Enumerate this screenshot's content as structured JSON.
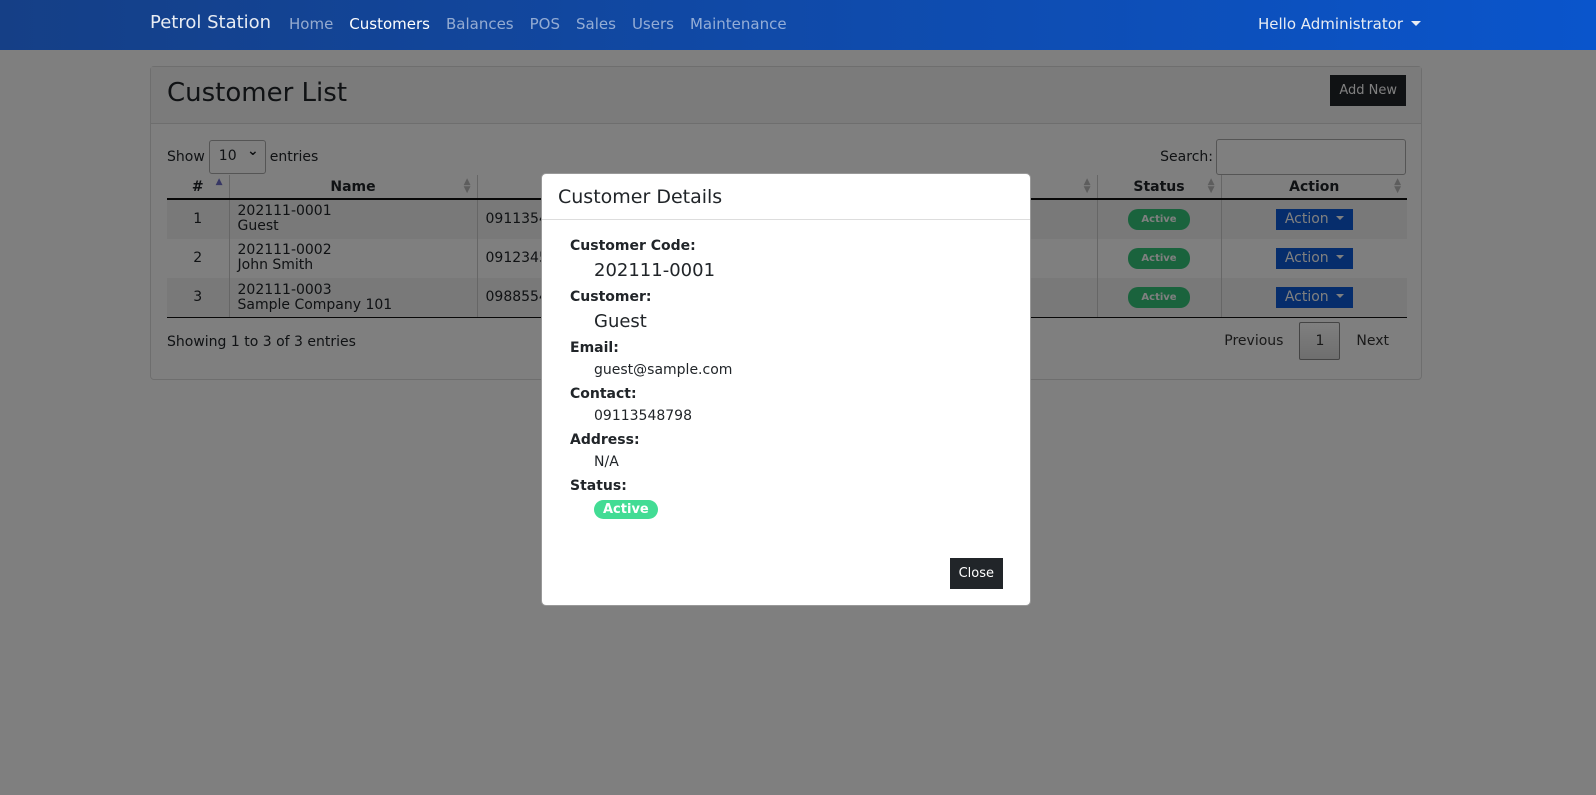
{
  "navbar": {
    "brand": "Petrol Station",
    "links": [
      {
        "label": "Home"
      },
      {
        "label": "Customers",
        "active": true
      },
      {
        "label": "Balances"
      },
      {
        "label": "POS"
      },
      {
        "label": "Sales"
      },
      {
        "label": "Users"
      },
      {
        "label": "Maintenance"
      }
    ],
    "user": "Hello Administrator"
  },
  "card": {
    "title": "Customer List",
    "add_label": "Add New"
  },
  "length": {
    "show": "Show",
    "value": "10",
    "entries": "entries"
  },
  "search": {
    "label": "Search:",
    "value": ""
  },
  "table": {
    "headers": [
      "#",
      "Name",
      "",
      "Status",
      "Action"
    ],
    "rows": [
      {
        "num": "1",
        "code": "202111-0001",
        "name": "Guest",
        "contact": "0911354",
        "status": "Active",
        "action": "Action"
      },
      {
        "num": "2",
        "code": "202111-0002",
        "name": "John Smith",
        "contact": "0912345",
        "status": "Active",
        "action": "Action"
      },
      {
        "num": "3",
        "code": "202111-0003",
        "name": "Sample Company 101",
        "contact": "0988554",
        "status": "Active",
        "action": "Action"
      }
    ]
  },
  "info": "Showing 1 to 3 of 3 entries",
  "pagination": {
    "previous": "Previous",
    "page": "1",
    "next": "Next"
  },
  "modal": {
    "title": "Customer Details",
    "fields": [
      {
        "label": "Customer Code:",
        "value": "202111-0001"
      },
      {
        "label": "Customer:",
        "value": "Guest"
      },
      {
        "label": "Email:",
        "value": "guest@sample.com"
      },
      {
        "label": "Contact:",
        "value": "09113548798"
      },
      {
        "label": "Address:",
        "value": "N/A"
      },
      {
        "label": "Status:",
        "value": "Active"
      }
    ],
    "close_label": "Close"
  },
  "colors": {
    "navbar": "#0a55cc",
    "active_badge": "#42dc94",
    "action_button": "#0d5bd8",
    "dark_button": "#212529"
  }
}
